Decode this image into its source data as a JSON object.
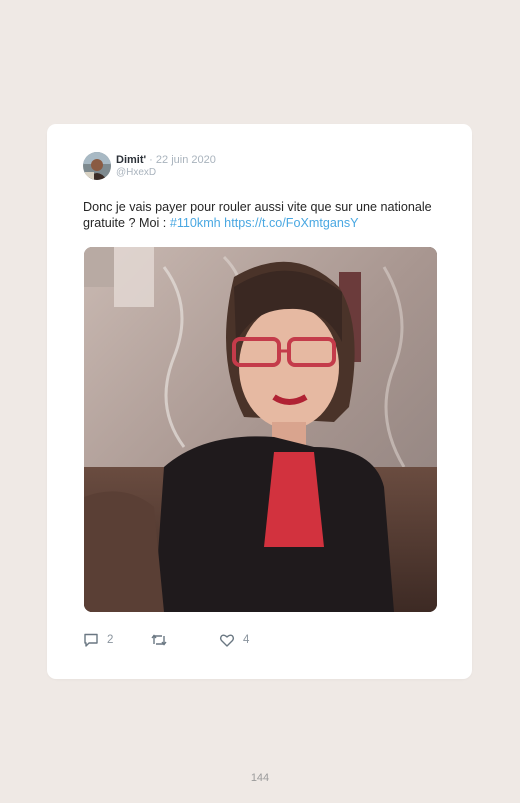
{
  "tweet": {
    "author_name": "Dimit'",
    "separator": " · ",
    "date": "22 juin 2020",
    "handle": "@HxexD",
    "text_plain": "Donc je vais payer pour rouler aussi vite que sur une nationale gratuite ? Moi : ",
    "hashtag": "#110kmh",
    "link": " https://t.co/FoXmtgansY"
  },
  "actions": {
    "reply_icon": "reply-icon",
    "reply_count": "2",
    "retweet_icon": "retweet-icon",
    "like_icon": "heart-icon",
    "like_count": "4"
  },
  "footer": {
    "page_number": "144"
  },
  "colors": {
    "page_bg": "#efe9e5",
    "card_bg": "#ffffff",
    "link": "#4aa8e2",
    "muted": "#a9b3bd"
  }
}
